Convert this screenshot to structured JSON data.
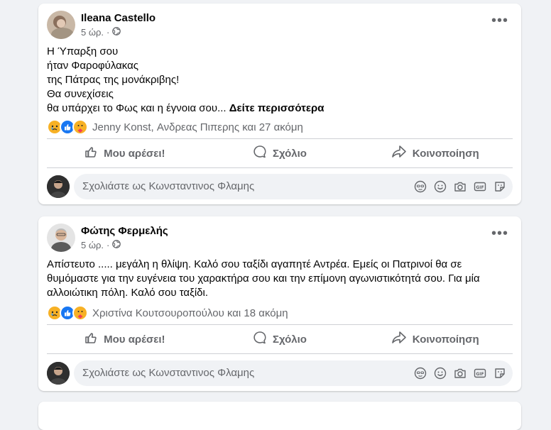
{
  "posts": [
    {
      "author": "Ileana Castello",
      "time": "5 ώρ.",
      "lines": [
        "Η Ύπαρξη σου",
        "ήταν Φαροφύλακας",
        "της Πάτρας της μονάκριβης!",
        "Θα συνεχίσεις",
        "θα υπάρχει το Φως και η έγνοια σου..."
      ],
      "see_more": "Δείτε περισσότερα",
      "reactions_text": "Jenny Konst, Ανδρεας Πιπερης και 27 ακόμη"
    },
    {
      "author": "Φώτης Φερμελής",
      "time": "5 ώρ.",
      "lines": [
        "Απίστευτο ..... μεγάλη η θλίψη. Καλό σου ταξίδι αγαπητέ Αντρέα. Εμείς οι Πατρινοί θα σε",
        "θυμόμαστε για την ευγένεια του χαρακτήρα σου και  την επίμονη αγωνιστικότητά σου. Για μία",
        "αλλοιώτικη πόλη. Καλό σου ταξίδι."
      ],
      "reactions_text": "Χριστίνα Κουτσουροπούλου και 18 ακόμη"
    }
  ],
  "actions": {
    "like": "Μου αρέσει!",
    "comment": "Σχόλιο",
    "share": "Κοινοποίηση"
  },
  "comment_box": {
    "placeholder": "Σχολιάστε ως Κωνσταντινος Φλαμης"
  },
  "icons": {
    "privacy": "globe-icon",
    "more": "more-options-icon",
    "like": "thumbs-up-icon",
    "comment": "speech-bubble-icon",
    "share": "share-arrow-icon",
    "avatar_sticker": "avatar-sticker-icon",
    "emoji": "emoji-icon",
    "camera": "camera-icon",
    "gif": "gif-icon",
    "sticker": "sticker-icon"
  },
  "colors": {
    "background": "#f0f2f5",
    "like_blue": "#1877f2",
    "secondary_text": "#65676b",
    "care_yellow": "#f7b125",
    "sad_yellow": "#f7b125"
  }
}
